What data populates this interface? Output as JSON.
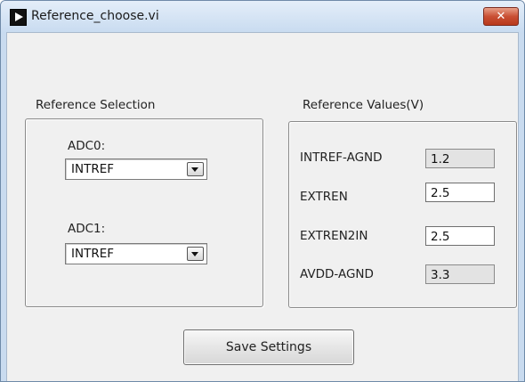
{
  "window": {
    "title": "Reference_choose.vi",
    "close_label": "✕"
  },
  "reference_selection": {
    "label": "Reference Selection",
    "adc0": {
      "label": "ADC0:",
      "value": "INTREF"
    },
    "adc1": {
      "label": "ADC1:",
      "value": "INTREF"
    }
  },
  "reference_values": {
    "label": "Reference Values(V)",
    "rows": [
      {
        "label": "INTREF-AGND",
        "value": "1.2",
        "editable": false
      },
      {
        "label": "EXTREN",
        "value": "2.5",
        "editable": true
      },
      {
        "label": "EXTREN2IN",
        "value": "2.5",
        "editable": true
      },
      {
        "label": "AVDD-AGND",
        "value": "3.3",
        "editable": false
      }
    ]
  },
  "actions": {
    "save_label": "Save Settings"
  },
  "icons": {
    "app": "labview-run-icon",
    "dropdown": "chevron-down-icon",
    "close": "close-icon"
  },
  "colors": {
    "titlebar": "#c8dbf0",
    "close_button": "#c94f33",
    "panel": "#f0f0f0"
  }
}
